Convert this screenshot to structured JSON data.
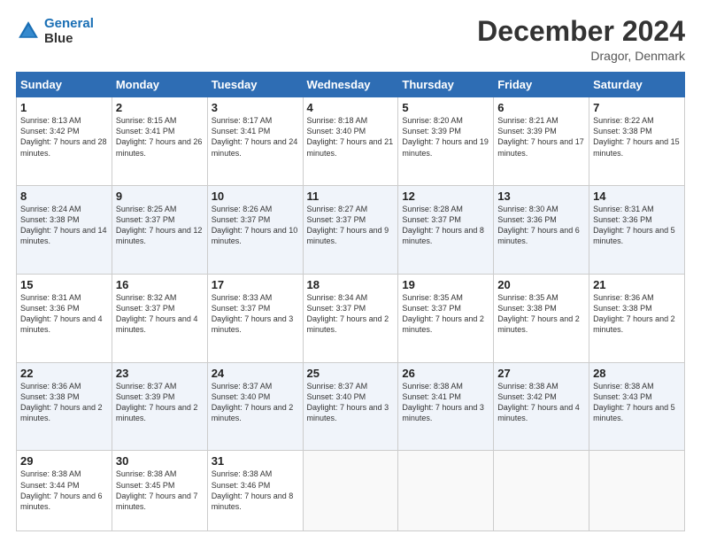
{
  "logo": {
    "line1": "General",
    "line2": "Blue"
  },
  "title": "December 2024",
  "location": "Dragor, Denmark",
  "days_of_week": [
    "Sunday",
    "Monday",
    "Tuesday",
    "Wednesday",
    "Thursday",
    "Friday",
    "Saturday"
  ],
  "weeks": [
    [
      {
        "day": "1",
        "sunrise": "8:13 AM",
        "sunset": "3:42 PM",
        "daylight": "7 hours and 28 minutes."
      },
      {
        "day": "2",
        "sunrise": "8:15 AM",
        "sunset": "3:41 PM",
        "daylight": "7 hours and 26 minutes."
      },
      {
        "day": "3",
        "sunrise": "8:17 AM",
        "sunset": "3:41 PM",
        "daylight": "7 hours and 24 minutes."
      },
      {
        "day": "4",
        "sunrise": "8:18 AM",
        "sunset": "3:40 PM",
        "daylight": "7 hours and 21 minutes."
      },
      {
        "day": "5",
        "sunrise": "8:20 AM",
        "sunset": "3:39 PM",
        "daylight": "7 hours and 19 minutes."
      },
      {
        "day": "6",
        "sunrise": "8:21 AM",
        "sunset": "3:39 PM",
        "daylight": "7 hours and 17 minutes."
      },
      {
        "day": "7",
        "sunrise": "8:22 AM",
        "sunset": "3:38 PM",
        "daylight": "7 hours and 15 minutes."
      }
    ],
    [
      {
        "day": "8",
        "sunrise": "8:24 AM",
        "sunset": "3:38 PM",
        "daylight": "7 hours and 14 minutes."
      },
      {
        "day": "9",
        "sunrise": "8:25 AM",
        "sunset": "3:37 PM",
        "daylight": "7 hours and 12 minutes."
      },
      {
        "day": "10",
        "sunrise": "8:26 AM",
        "sunset": "3:37 PM",
        "daylight": "7 hours and 10 minutes."
      },
      {
        "day": "11",
        "sunrise": "8:27 AM",
        "sunset": "3:37 PM",
        "daylight": "7 hours and 9 minutes."
      },
      {
        "day": "12",
        "sunrise": "8:28 AM",
        "sunset": "3:37 PM",
        "daylight": "7 hours and 8 minutes."
      },
      {
        "day": "13",
        "sunrise": "8:30 AM",
        "sunset": "3:36 PM",
        "daylight": "7 hours and 6 minutes."
      },
      {
        "day": "14",
        "sunrise": "8:31 AM",
        "sunset": "3:36 PM",
        "daylight": "7 hours and 5 minutes."
      }
    ],
    [
      {
        "day": "15",
        "sunrise": "8:31 AM",
        "sunset": "3:36 PM",
        "daylight": "7 hours and 4 minutes."
      },
      {
        "day": "16",
        "sunrise": "8:32 AM",
        "sunset": "3:37 PM",
        "daylight": "7 hours and 4 minutes."
      },
      {
        "day": "17",
        "sunrise": "8:33 AM",
        "sunset": "3:37 PM",
        "daylight": "7 hours and 3 minutes."
      },
      {
        "day": "18",
        "sunrise": "8:34 AM",
        "sunset": "3:37 PM",
        "daylight": "7 hours and 2 minutes."
      },
      {
        "day": "19",
        "sunrise": "8:35 AM",
        "sunset": "3:37 PM",
        "daylight": "7 hours and 2 minutes."
      },
      {
        "day": "20",
        "sunrise": "8:35 AM",
        "sunset": "3:38 PM",
        "daylight": "7 hours and 2 minutes."
      },
      {
        "day": "21",
        "sunrise": "8:36 AM",
        "sunset": "3:38 PM",
        "daylight": "7 hours and 2 minutes."
      }
    ],
    [
      {
        "day": "22",
        "sunrise": "8:36 AM",
        "sunset": "3:38 PM",
        "daylight": "7 hours and 2 minutes."
      },
      {
        "day": "23",
        "sunrise": "8:37 AM",
        "sunset": "3:39 PM",
        "daylight": "7 hours and 2 minutes."
      },
      {
        "day": "24",
        "sunrise": "8:37 AM",
        "sunset": "3:40 PM",
        "daylight": "7 hours and 2 minutes."
      },
      {
        "day": "25",
        "sunrise": "8:37 AM",
        "sunset": "3:40 PM",
        "daylight": "7 hours and 3 minutes."
      },
      {
        "day": "26",
        "sunrise": "8:38 AM",
        "sunset": "3:41 PM",
        "daylight": "7 hours and 3 minutes."
      },
      {
        "day": "27",
        "sunrise": "8:38 AM",
        "sunset": "3:42 PM",
        "daylight": "7 hours and 4 minutes."
      },
      {
        "day": "28",
        "sunrise": "8:38 AM",
        "sunset": "3:43 PM",
        "daylight": "7 hours and 5 minutes."
      }
    ],
    [
      {
        "day": "29",
        "sunrise": "8:38 AM",
        "sunset": "3:44 PM",
        "daylight": "7 hours and 6 minutes."
      },
      {
        "day": "30",
        "sunrise": "8:38 AM",
        "sunset": "3:45 PM",
        "daylight": "7 hours and 7 minutes."
      },
      {
        "day": "31",
        "sunrise": "8:38 AM",
        "sunset": "3:46 PM",
        "daylight": "7 hours and 8 minutes."
      },
      null,
      null,
      null,
      null
    ]
  ],
  "labels": {
    "sunrise": "Sunrise:",
    "sunset": "Sunset:",
    "daylight": "Daylight:"
  }
}
